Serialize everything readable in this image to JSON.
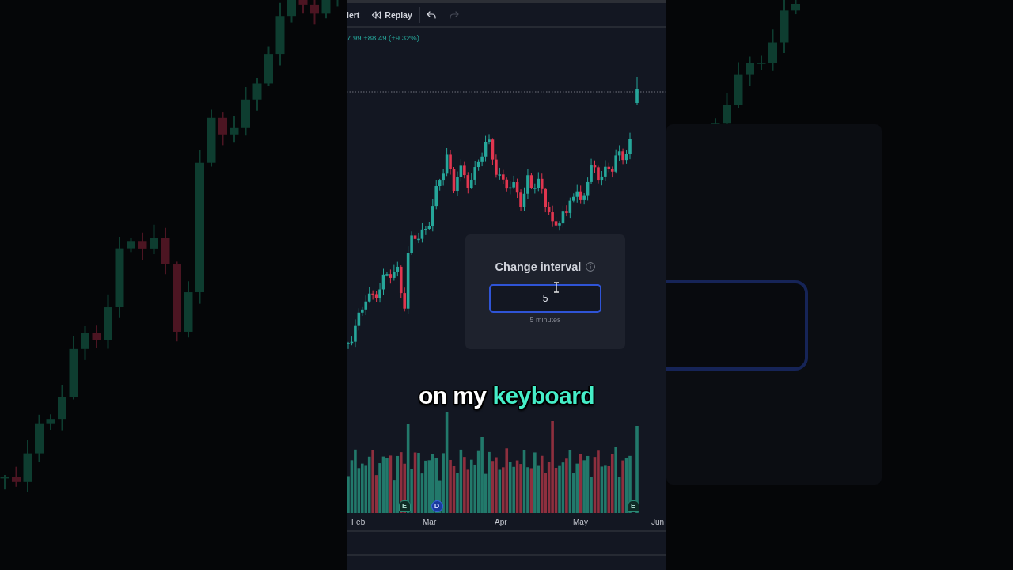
{
  "toolbar": {
    "items": [
      {
        "kind": "text",
        "label": "lert",
        "disabled": false
      },
      {
        "kind": "replay",
        "label": "Replay",
        "disabled": false
      },
      {
        "kind": "undo",
        "disabled": false
      },
      {
        "kind": "redo",
        "disabled": true
      }
    ]
  },
  "chart": {
    "price_change": "7.99 +88.49 (+9.32%)",
    "events": [
      {
        "kind": "earnings",
        "label": "E"
      },
      {
        "kind": "dividend",
        "label": "D"
      },
      {
        "kind": "earnings",
        "label": "E"
      }
    ],
    "x_axis_labels": [
      "Feb",
      "Mar",
      "Apr",
      "May",
      "Jun"
    ]
  },
  "dialog": {
    "title": "Change interval",
    "input": {
      "value": "5",
      "focused": true
    },
    "hint": "5 minutes"
  },
  "caption": {
    "words": [
      {
        "text": "on my",
        "highlight": false
      },
      {
        "text": "keyboard",
        "highlight": true
      }
    ]
  }
}
